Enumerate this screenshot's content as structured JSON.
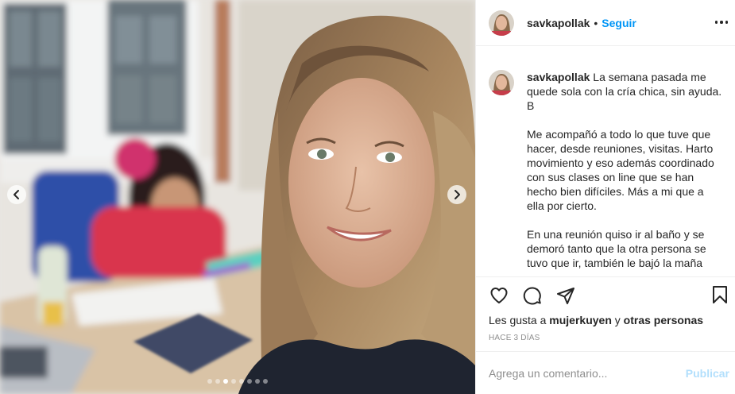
{
  "post": {
    "username": "savkapollak",
    "separator": "•",
    "follow_label": "Seguir",
    "caption_paragraphs": [
      "La semana pasada me quede sola con la cría chica, sin ayuda. B",
      "Me acompañó a todo lo que tuve que hacer, desde reuniones, visitas. Harto movimiento y eso además coordinado con sus clases on line que se han hecho bien difíciles. Más a mi que a ella por cierto.",
      "En una reunión quiso ir al baño y se demoró tanto que la otra persona se tuvo que ir, también le bajó la maña"
    ],
    "likes_prefix": "Les gusta a",
    "likes_user": "mujerkuyen",
    "likes_conjunction": "y",
    "likes_others": "otras personas",
    "time_ago": "HACE 3 DÍAS"
  },
  "comment_box": {
    "placeholder": "Agrega un comentario...",
    "publish_label": "Publicar"
  },
  "carousel": {
    "slide_count": 8,
    "active_index": 2
  },
  "icons": {
    "like": "heart-icon",
    "comment": "comment-bubble-icon",
    "share": "paper-plane-icon",
    "save": "bookmark-icon",
    "more": "more-options-icon",
    "prev": "chevron-left-icon",
    "next": "chevron-right-icon"
  },
  "colors": {
    "accent": "#0095f6",
    "publish_disabled": "#b2dffc",
    "text": "#262626",
    "muted": "#8e8e8e",
    "border": "#efefef"
  }
}
